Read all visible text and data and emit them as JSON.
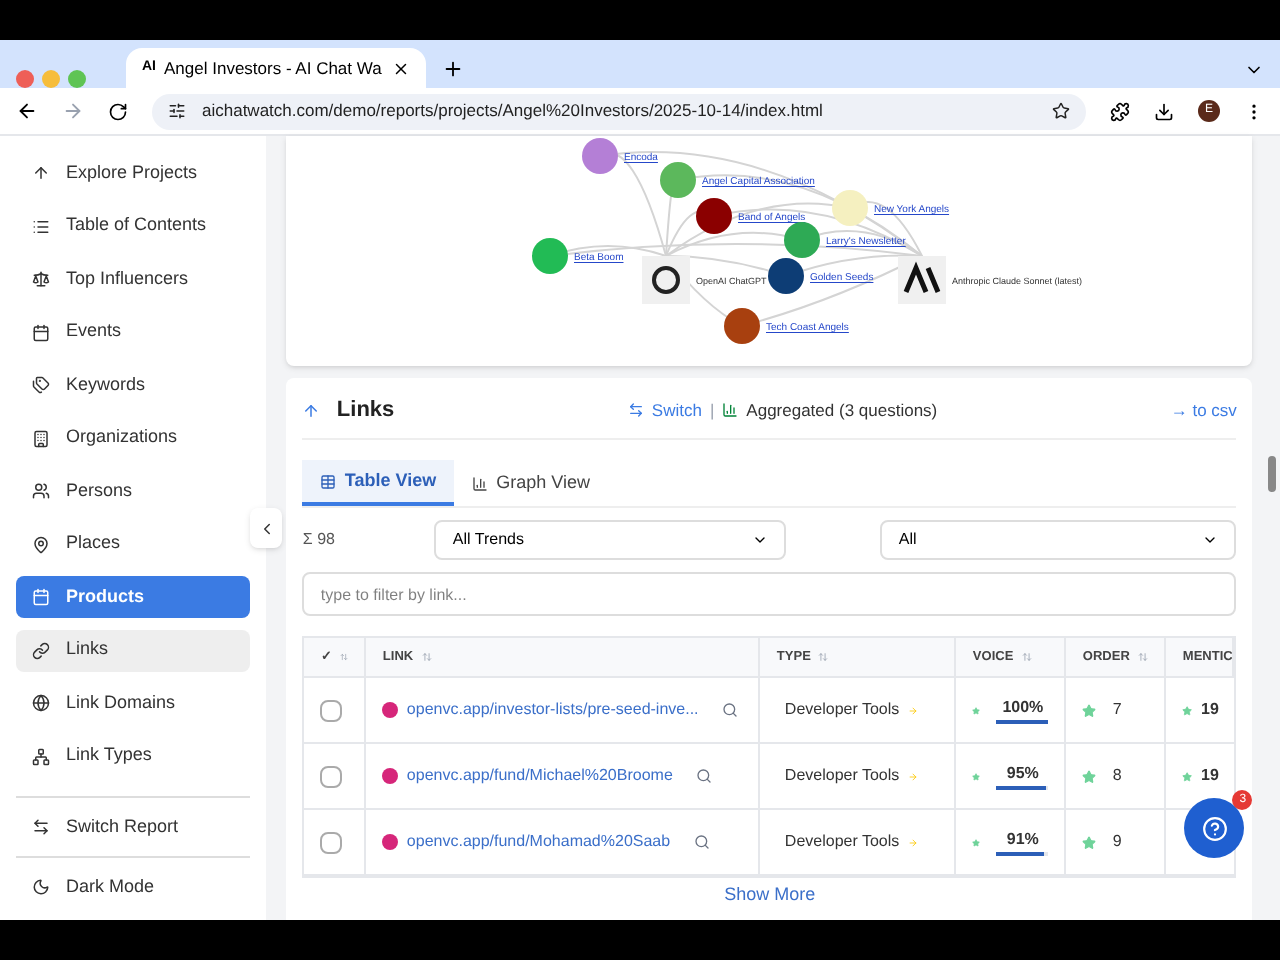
{
  "browser": {
    "tab_title": "Angel Investors - AI Chat Wa",
    "tab_logo": "AI",
    "url": "aichatwatch.com/demo/reports/projects/Angel%20Investors/2025-10-14/index.html",
    "profile_initial": "E"
  },
  "sidebar": {
    "items": [
      {
        "label": "Explore Projects",
        "selected": false,
        "hovered": false
      },
      {
        "label": "Table of Contents",
        "selected": false,
        "hovered": false
      },
      {
        "label": "Top Influencers",
        "selected": false,
        "hovered": false
      },
      {
        "label": "Events",
        "selected": false,
        "hovered": false
      },
      {
        "label": "Keywords",
        "selected": false,
        "hovered": false
      },
      {
        "label": "Organizations",
        "selected": false,
        "hovered": false
      },
      {
        "label": "Persons",
        "selected": false,
        "hovered": false
      },
      {
        "label": "Places",
        "selected": false,
        "hovered": false
      },
      {
        "label": "Products",
        "selected": true,
        "hovered": false
      },
      {
        "label": "Links",
        "selected": false,
        "hovered": true
      },
      {
        "label": "Link Domains",
        "selected": false,
        "hovered": false
      },
      {
        "label": "Link Types",
        "selected": false,
        "hovered": false
      }
    ],
    "switch_report": "Switch Report",
    "dark_mode": "Dark Mode"
  },
  "graph": {
    "nodes": [
      {
        "label": "Encoda",
        "color": "#b47fd6"
      },
      {
        "label": "Angel Capital Association",
        "color": "#5cb85c"
      },
      {
        "label": "Band of Angels",
        "color": "#8b0000"
      },
      {
        "label": "New York Angels",
        "color": "#f5f0c0"
      },
      {
        "label": "Larry's Newsletter",
        "color": "#2eaa55"
      },
      {
        "label": "Beta Boom",
        "color": "#22bb55"
      },
      {
        "label": "Golden Seeds",
        "color": "#0d3d75"
      },
      {
        "label": "Tech Coast Angels",
        "color": "#a8400f"
      }
    ],
    "hubs": [
      {
        "label": "OpenAI ChatGPT",
        "kind": "openai"
      },
      {
        "label": "Anthropic Claude Sonnet (latest)",
        "kind": "anthropic"
      }
    ]
  },
  "links": {
    "title": "Links",
    "switch": "Switch",
    "separator": "|",
    "aggregated": "Aggregated (3 questions)",
    "csv": "→ to csv",
    "tabs": [
      {
        "label": "Table View",
        "selected": true
      },
      {
        "label": "Graph View",
        "selected": false
      }
    ],
    "count": "Σ 98",
    "trend_select": "All Trends",
    "type_select": "All",
    "filter_placeholder": "type to filter by link...",
    "columns": [
      "✓",
      "LINK",
      "TYPE",
      "VOICE",
      "ORDER",
      "MENTIC"
    ],
    "rows": [
      {
        "checked": false,
        "link": "openvc.app/investor-lists/pre-seed-inve...",
        "type": "Developer Tools",
        "voice": "100%",
        "level": 1.0,
        "order": "7",
        "mentions": "19"
      },
      {
        "checked": false,
        "link": "openvc.app/fund/Michael%20Broome",
        "type": "Developer Tools",
        "voice": "95%",
        "level": 0.95,
        "order": "8",
        "mentions": "19"
      },
      {
        "checked": false,
        "link": "openvc.app/fund/Mohamad%20Saab",
        "type": "Developer Tools",
        "voice": "91%",
        "level": 0.91,
        "order": "9"
      }
    ],
    "show_more": "Show More"
  },
  "help_badge": "3"
}
